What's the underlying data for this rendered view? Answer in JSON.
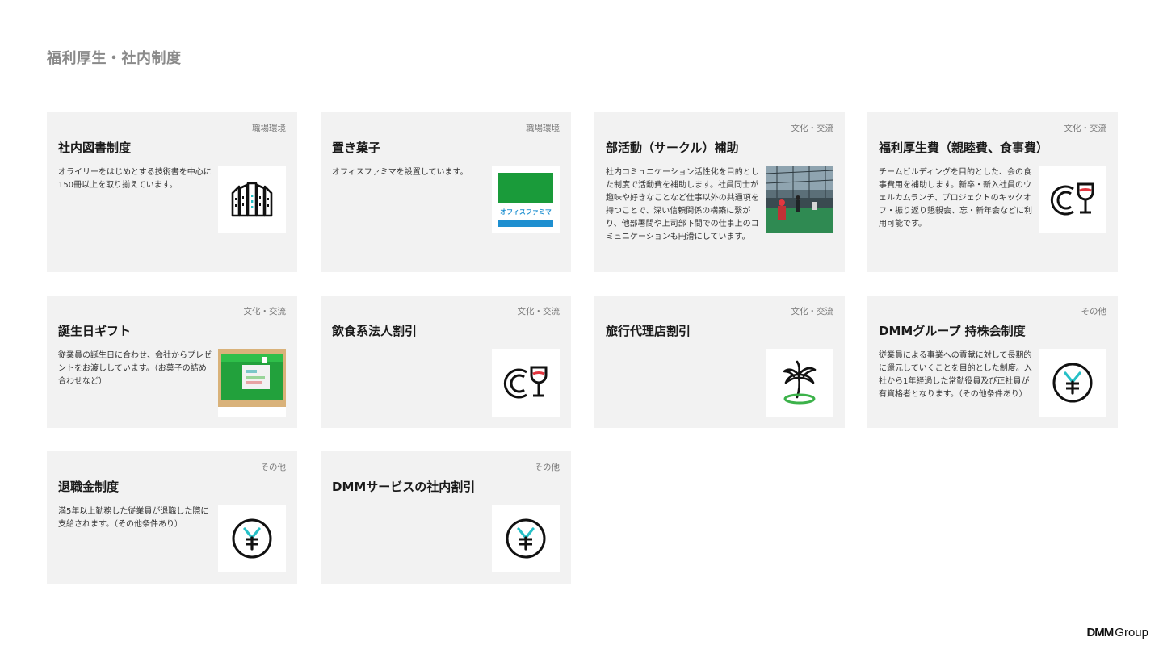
{
  "page": {
    "title": "福利厚生・社内制度"
  },
  "cards": [
    {
      "category": "職場環境",
      "title": "社内図書制度",
      "desc": "オライリーをはじめとする技術書を中心に150冊以上を取り揃えています。",
      "icon": "bookshelf-icon"
    },
    {
      "category": "職場環境",
      "title": "置き菓子",
      "desc": "オフィスファミマを設置しています。",
      "icon": "office-famima-logo",
      "logo_text": "オフィスファミマ"
    },
    {
      "category": "文化・交流",
      "title": "部活動（サークル）補助",
      "desc": "社内コミュニケーション活性化を目的とした制度で活動費を補助します。社員同士が趣味や好きなことなど仕事以外の共通項を持つことで、深い信頼関係の構築に繋がり、他部署間や上司部下間での仕事上のコミュニケーションも円滑にしています。",
      "icon": "club-activity-photo"
    },
    {
      "category": "文化・交流",
      "title": "福利厚生費（親睦費、食事費）",
      "desc": "チームビルディングを目的とした、会の食事費用を補助します。新卒・新入社員のウェルカムランチ、プロジェクトのキックオフ・振り返り懇親会、忘・新年会などに利用可能です。",
      "icon": "dining-icon"
    },
    {
      "category": "文化・交流",
      "title": "誕生日ギフト",
      "desc": "従業員の誕生日に合わせ、会社からプレゼントをお渡ししています。（お菓子の詰め合わせなど）",
      "icon": "gift-box-photo"
    },
    {
      "category": "文化・交流",
      "title": "飲食系法人割引",
      "desc": "",
      "icon": "dining-icon"
    },
    {
      "category": "文化・交流",
      "title": "旅行代理店割引",
      "desc": "",
      "icon": "palm-tree-icon"
    },
    {
      "category": "その他",
      "title": "DMMグループ 持株会制度",
      "desc": "従業員による事業への貢献に対して長期的に還元していくことを目的とした制度。入社から1年経過した常勤役員及び正社員が有資格者となります。（その他条件あり）",
      "icon": "yen-icon"
    },
    {
      "category": "その他",
      "title": "退職金制度",
      "desc": "満5年以上勤務した従業員が退職した際に支給されます。（その他条件あり）",
      "icon": "yen-icon"
    },
    {
      "category": "その他",
      "title": "DMMサービスの社内割引",
      "desc": "",
      "icon": "yen-icon"
    }
  ],
  "colors": {
    "card_bg": "#f2f2f2",
    "famima_green": "#1a9b3a",
    "famima_blue": "#1e8fd0",
    "accent_red": "#e3363f",
    "accent_teal": "#26c0c7",
    "palm_green": "#3cb24a"
  },
  "footer": {
    "brand": "DMM",
    "suffix": "Group"
  }
}
